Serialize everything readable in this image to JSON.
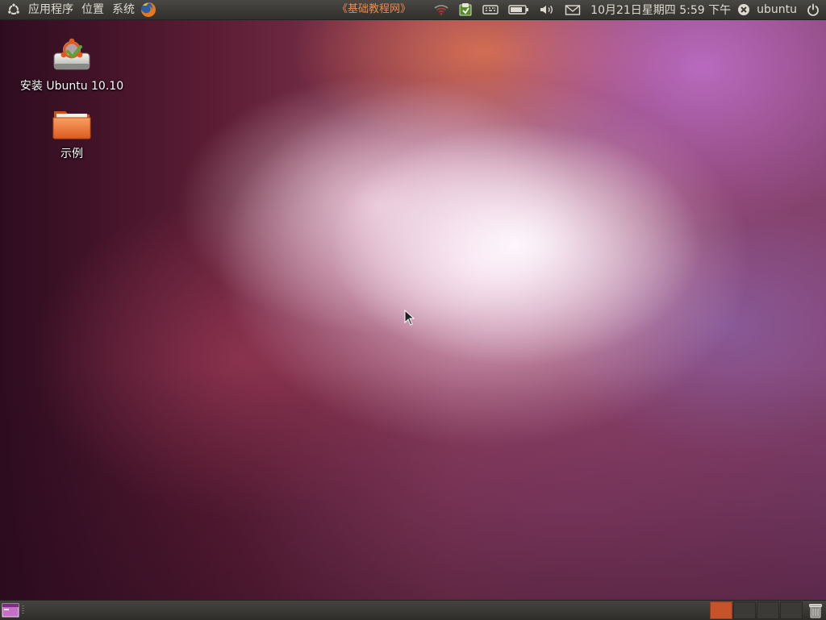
{
  "top_panel": {
    "menus": [
      "应用程序",
      "位置",
      "系统"
    ],
    "center_text": "《基础教程网》",
    "clock": "10月21日星期四  5:59 下午",
    "user": "ubuntu",
    "icons": {
      "logo": "ubuntu-logo-icon",
      "browser": "firefox-icon",
      "network": "wifi-icon",
      "update": "update-manager-icon",
      "keyboard": "keyboard-icon",
      "battery": "battery-icon",
      "volume": "volume-icon",
      "mail": "envelope-icon",
      "status": "user-status-icon",
      "power": "power-icon"
    }
  },
  "desktop": {
    "icons": [
      {
        "label": "安装 Ubuntu 10.10",
        "icon": "installer-drive-icon"
      },
      {
        "label": "示例",
        "icon": "folder-icon"
      }
    ]
  },
  "bottom_panel": {
    "workspaces": 4,
    "active_workspace": 1,
    "icons": {
      "show_desktop": "show-desktop-icon",
      "trash": "trash-icon"
    }
  },
  "colors": {
    "panel": "#3c3b37",
    "panel_text": "#dfdbd2",
    "accent": "#f08a4b",
    "active_workspace": "#c6532a"
  }
}
